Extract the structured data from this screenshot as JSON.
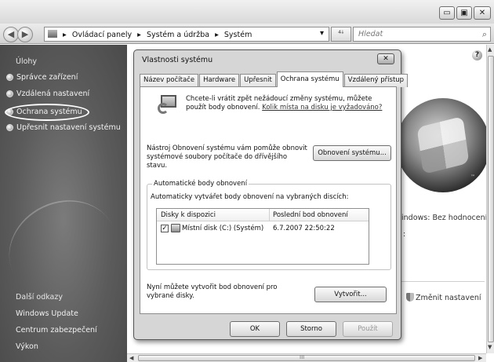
{
  "window": {
    "minimize_glyph": "▭",
    "maximize_glyph": "▣",
    "close_glyph": "✕"
  },
  "address": {
    "breadcrumbs": [
      "Ovládací panely",
      "Systém a údržba",
      "Systém"
    ],
    "separator": "▸",
    "dropdown_glyph": "▾",
    "refresh_glyph": "⁴ꜜ",
    "search_placeholder": "Hledat",
    "search_glyph": "⌕"
  },
  "sidebar": {
    "tasks_heading": "Úlohy",
    "tasks": [
      "Správce zařízení",
      "Vzdálená nastavení",
      "Ochrana systému",
      "Upřesnit nastavení systému"
    ],
    "other_heading": "Další odkazy",
    "other_links": [
      "Windows Update",
      "Centrum zabezpečení",
      "Výkon"
    ]
  },
  "background": {
    "rating_text": "indows: Bez hodnocení",
    "change_settings": "Změnit nastavení",
    "tm": "™",
    "help_glyph": "?",
    "hscroll_center": "III"
  },
  "dialog": {
    "title": "Vlastnosti systému",
    "close_glyph": "✕",
    "tabs": [
      "Název počítače",
      "Hardware",
      "Upřesnit",
      "Ochrana systému",
      "Vzdálený přístup"
    ],
    "active_tab_index": 3,
    "intro_text": "Chcete-li vrátit zpět nežádoucí změny systému, můžete použít body obnovení.",
    "intro_link": "Kolik místa na disku je vyžadováno?",
    "restore_desc": "Nástroj Obnovení systému vám pomůže obnovit systémové soubory počítače do dřívějšího stavu.",
    "restore_button": "Obnovení systému...",
    "group": {
      "legend": "Automatické body obnovení",
      "description": "Automaticky vytvářet body obnovení na vybraných discích:",
      "columns": [
        "Disky k dispozici",
        "Poslední bod obnovení"
      ],
      "rows": [
        {
          "checked": true,
          "check_glyph": "✓",
          "name": "Místní disk (C:) (Systém)",
          "last_restore": "6.7.2007 22:50:22"
        }
      ]
    },
    "create_desc": "Nyní můžete vytvořit bod obnovení pro vybrané disky.",
    "create_button": "Vytvořit...",
    "ok_button": "OK",
    "cancel_button": "Storno",
    "apply_button": "Použít"
  }
}
